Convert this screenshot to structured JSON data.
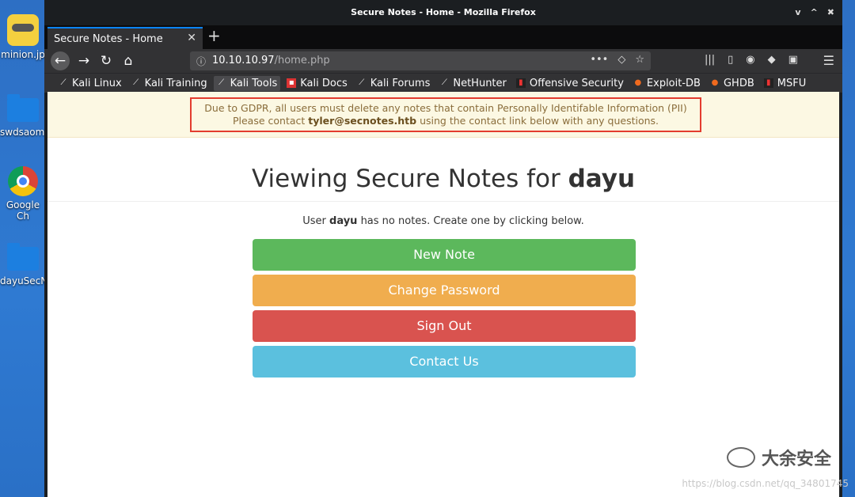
{
  "desktop": {
    "icons": [
      {
        "label": "minion.jp"
      },
      {
        "label": "swdsaomi"
      },
      {
        "label": "Google Ch"
      },
      {
        "label": "dayuSecN"
      }
    ]
  },
  "window": {
    "title": "Secure Notes - Home - Mozilla Firefox",
    "controls": [
      "v",
      "^",
      "✖"
    ]
  },
  "tab": {
    "label": "Secure Notes - Home",
    "close": "✕"
  },
  "newtab": "+",
  "nav": {
    "back": "←",
    "forward": "→",
    "reload": "↻",
    "home": "⌂"
  },
  "url": {
    "host": "10.10.10.97",
    "path": "/home.php"
  },
  "bookmarks": [
    {
      "label": "Kali Linux",
      "icon": "kali-icon"
    },
    {
      "label": "Kali Training",
      "icon": "kali-icon"
    },
    {
      "label": "Kali Tools",
      "icon": "kali-icon",
      "active": true
    },
    {
      "label": "Kali Docs",
      "icon": "docs-icon"
    },
    {
      "label": "Kali Forums",
      "icon": "kali-icon"
    },
    {
      "label": "NetHunter",
      "icon": "nethunter-icon"
    },
    {
      "label": "Offensive Security",
      "icon": "offsec-icon"
    },
    {
      "label": "Exploit-DB",
      "icon": "exploitdb-icon"
    },
    {
      "label": "GHDB",
      "icon": "ghdb-icon"
    },
    {
      "label": "MSFU",
      "icon": "msfu-icon"
    }
  ],
  "alert": {
    "line1": "Due to GDPR, all users must delete any notes that contain Personally Identifable Information (PII)",
    "line2_prefix": "Please contact ",
    "email": "tyler@secnotes.htb",
    "line2_suffix": " using the contact link below with any questions."
  },
  "page": {
    "heading_prefix": "Viewing Secure Notes for ",
    "username": "dayu",
    "notice_prefix": "User ",
    "notice_suffix": " has no notes. Create one by clicking below."
  },
  "buttons": {
    "new_note": "New Note",
    "change_password": "Change Password",
    "sign_out": "Sign Out",
    "contact_us": "Contact Us"
  },
  "watermark": {
    "text": "大余安全",
    "csdn": "https://blog.csdn.net/qq_34801745"
  }
}
